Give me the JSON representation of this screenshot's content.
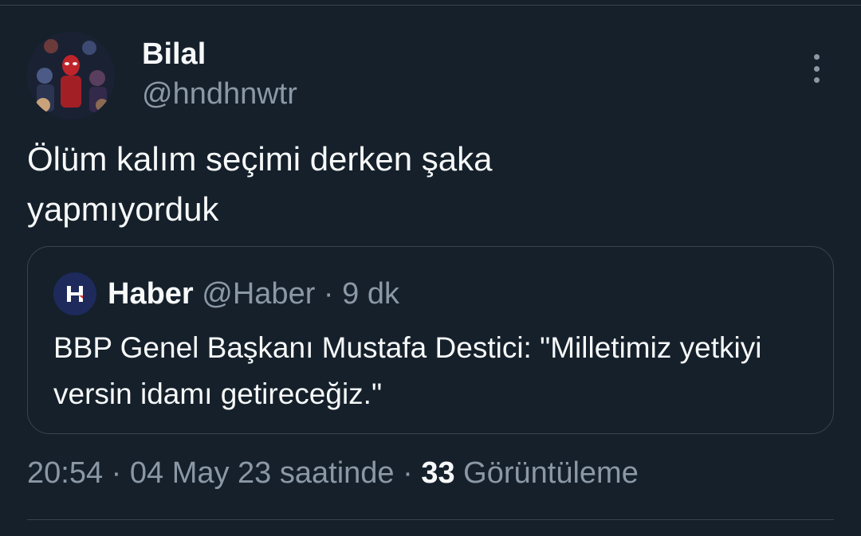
{
  "author": {
    "name": "Bilal",
    "handle": "@hndhnwtr"
  },
  "tweet": {
    "text": "Ölüm kalım seçimi derken şaka\nyapmıyorduk"
  },
  "quote": {
    "avatar_letter": "H",
    "name": "Haber",
    "handle": "@Haber",
    "separator": " · ",
    "time": "9 dk",
    "text": "BBP Genel Başkanı Mustafa Destici: \"Milletimiz yetkiyi versin idamı getireceğiz.\""
  },
  "meta": {
    "time": "20:54",
    "separator": " · ",
    "date": "04 May 23 saatinde",
    "views_count": "33",
    "views_label": "Görüntüleme"
  },
  "colors": {
    "background": "#15202b",
    "primary_text": "#f7f9f9",
    "secondary_text": "#8b98a5",
    "border": "#38444d",
    "quote_avatar_bg": "#1d2a5b"
  },
  "icons": {
    "more": "more-vertical-icon"
  }
}
